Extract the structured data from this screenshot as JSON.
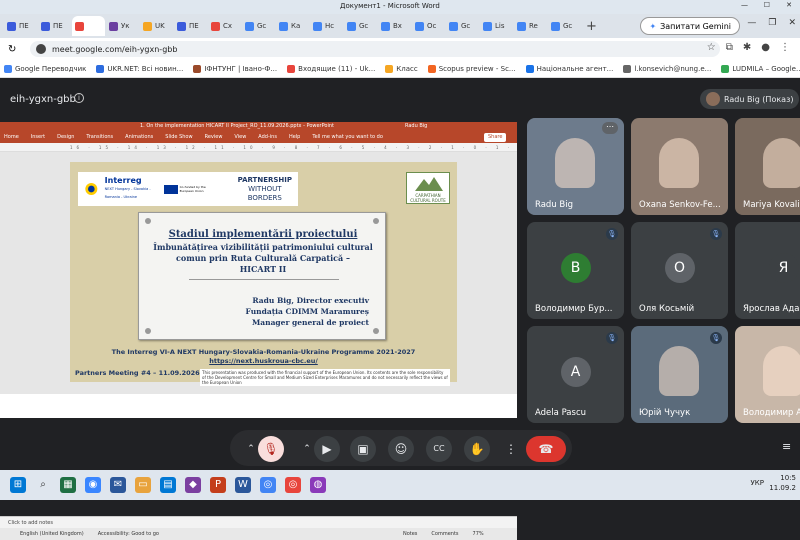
{
  "window": {
    "title": "Документ1 - Microsoft Word",
    "min": "—",
    "max": "☐",
    "close": "✕"
  },
  "tabs": [
    {
      "label": "ПЕ",
      "color": "#3b5bdb"
    },
    {
      "label": "ПЕ",
      "color": "#3b5bdb"
    },
    {
      "label": "",
      "color": "#e8453c",
      "active": true
    },
    {
      "label": "Ук",
      "color": "#6b3fa0"
    },
    {
      "label": "UK",
      "color": "#f5a623"
    },
    {
      "label": "ПЕ",
      "color": "#3b5bdb"
    },
    {
      "label": "Сх",
      "color": "#e8453c"
    },
    {
      "label": "Gc",
      "color": "#4285f4"
    },
    {
      "label": "Ка",
      "color": "#4285f4"
    },
    {
      "label": "Нс",
      "color": "#4285f4"
    },
    {
      "label": "Gc",
      "color": "#4285f4"
    },
    {
      "label": "Вх",
      "color": "#4285f4"
    },
    {
      "label": "Ос",
      "color": "#4285f4"
    },
    {
      "label": "Gc",
      "color": "#4285f4"
    },
    {
      "label": "Lis",
      "color": "#4285f4"
    },
    {
      "label": "Re",
      "color": "#4285f4"
    },
    {
      "label": "Gc",
      "color": "#4285f4"
    }
  ],
  "gemini": "Запитати Gemini",
  "url": "meet.google.com/eih-ygxn-gbb",
  "bookmarks": [
    {
      "label": "Google Переводчик",
      "color": "#4285f4"
    },
    {
      "label": "UKR.NET: Всі новин...",
      "color": "#2d6cdf"
    },
    {
      "label": "ІФНТУНГ | Івано-Ф...",
      "color": "#9a4a2a"
    },
    {
      "label": "Входящие (11) - Uk...",
      "color": "#e8453c"
    },
    {
      "label": "Класс",
      "color": "#f5a623"
    },
    {
      "label": "Scopus preview - Sc...",
      "color": "#f26522"
    },
    {
      "label": "Національне агент...",
      "color": "#1a73e8"
    },
    {
      "label": "l.konsevich@nung.e...",
      "color": "#666666"
    },
    {
      "label": "LUDMILA – Google...",
      "color": "#34a853"
    }
  ],
  "meeting": {
    "code": "eih-ygxn-gbb",
    "presenter": "Radu Big (Показ)",
    "info": "i"
  },
  "ppt": {
    "title": "1. On the implementation HICART II Project_RO_11.09.2026.pptx  -  PowerPoint",
    "user": "Radu Big",
    "ribbon": [
      "Home",
      "Insert",
      "Design",
      "Transitions",
      "Animations",
      "Slide Show",
      "Review",
      "View",
      "Add-ins",
      "Help",
      "Tell me what you want to do"
    ],
    "share": "Share",
    "ruler": "16 · 15 · 14 · 13 · 12 · 11 · 10 · 9 · 8 · 7 · 6 · 5 · 4 · 3 · 2 · 1 · 0 · 1 · 2 · 3 · 4 · 5 · 6 · 7 · 8 · 9 · 10 · 11 · 12 · 13 · 14 · 15 · 16",
    "notes": "Click to add notes",
    "status": [
      "English (United Kingdom)",
      "Accessibility: Good to go",
      "Notes",
      "Comments",
      "77%"
    ],
    "slide": {
      "interreg": "Interreg",
      "next": "NEXT Hungary - Slovakia - Romania - Ukraine",
      "eu": "Co-funded by the European Union",
      "partnership": "PARTNERSHIP",
      "without": "WITHOUT BORDERS",
      "carpathian": "CARPATHIAN CULTURAL ROUTE",
      "title": "Stadiul implementării proiectului",
      "sub1": "Îmbunătățirea vizibilității patrimoniului cultural",
      "sub2": "comun prin Ruta Culturală Carpatică –",
      "sub3": "HICART II",
      "author1": "Radu Big, Director executiv",
      "author2": "Fundația CDIMM Maramureș",
      "author3": "Manager general de proiect",
      "program": "The Interreg VI-A NEXT Hungary-Slovakia-Romania-Ukraine Programme 2021-2027",
      "link": "https://next.huskroua-cbc.eu/",
      "meeting": "Partners  Meeting #4 – 11.09.2026",
      "disclaimer": "This presentation was produced with the financial support of the European Union. Its contents are the sole responsibility of the Development Centre for Small and Medium Sized Enterprises Maramures and do not necessarily reflect the views of the European Union"
    }
  },
  "participants": [
    {
      "name": "Radu Big",
      "type": "photo",
      "bg": "#6d7b8c"
    },
    {
      "name": "Oxana Senkov-Fe...",
      "type": "photo",
      "bg": "#8c7a6e"
    },
    {
      "name": "Mariya Kovaliv",
      "type": "photo",
      "bg": "#7a6a5e"
    },
    {
      "name": "Володимир Бур...",
      "initial": "В",
      "avatar": "#2e7d32",
      "muted": true
    },
    {
      "name": "Оля Косьмій",
      "initial": "О",
      "avatar": "#5f6368",
      "muted": true
    },
    {
      "name": "Ярослав Адам...",
      "initial": "Я",
      "avatar": "#3c4043",
      "muted": true
    },
    {
      "name": "Adela Pascu",
      "initial": "A",
      "avatar": "#5f6368",
      "muted": true
    },
    {
      "name": "Юрій Чучук",
      "type": "photo",
      "bg": "#5b6b7b",
      "muted": true
    },
    {
      "name": "Володимир А...",
      "type": "photo",
      "bg": "#c8b7a8",
      "muted": false
    }
  ],
  "controls": {
    "more_opts": "⋯",
    "end_call": "☎"
  },
  "taskbar": {
    "lang": "УКР",
    "time": "10:5",
    "date": "11.09.2"
  }
}
